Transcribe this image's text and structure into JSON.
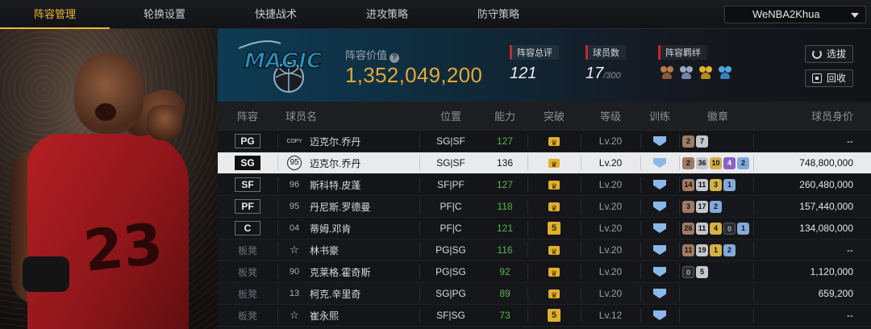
{
  "nav": {
    "tabs": [
      "阵容管理",
      "轮换设置",
      "快捷战术",
      "进攻策略",
      "防守策略"
    ],
    "active": 0,
    "account": "WeNBA2Khua"
  },
  "team": {
    "logo_text": "MAGIC",
    "value_label": "阵容价值",
    "value": "1,352,049,200",
    "overall_label": "阵容总评",
    "overall": "121",
    "players_label": "球员数",
    "players": "17",
    "players_max": "/300",
    "bond_label": "阵容羁绊",
    "bond_icons": [
      "bond-bronze-icon",
      "bond-silver-icon",
      "bond-gold-icon",
      "bond-blue-icon"
    ],
    "btn_select": "选拔",
    "btn_recycle": "回收"
  },
  "table": {
    "headers": [
      "阵容",
      "球员名",
      "位置",
      "能力",
      "突破",
      "等级",
      "训练",
      "徽章",
      "球员身价"
    ],
    "rows": [
      {
        "slot": "PG",
        "rank": "COPY",
        "name": "迈克尔.乔丹",
        "pos": "SG|SF",
        "ovr": "127",
        "brk": "",
        "lvl": "Lv.20",
        "badges": [
          {
            "t": "2",
            "c": "bronze"
          },
          {
            "t": "7",
            "c": "silver"
          }
        ],
        "price": "--"
      },
      {
        "slot": "SG",
        "rank": "95",
        "name": "迈克尔.乔丹",
        "pos": "SG|SF",
        "ovr": "136",
        "brk": "",
        "lvl": "Lv.20",
        "badges": [
          {
            "t": "2",
            "c": "bronze"
          },
          {
            "t": "36",
            "c": "silver"
          },
          {
            "t": "10",
            "c": "gold"
          },
          {
            "t": "4",
            "c": "purple"
          },
          {
            "t": "2",
            "c": "blue"
          }
        ],
        "price": "748,800,000"
      },
      {
        "slot": "SF",
        "rank": "96",
        "name": "斯科特.皮蓬",
        "pos": "SF|PF",
        "ovr": "127",
        "brk": "",
        "lvl": "Lv.20",
        "badges": [
          {
            "t": "14",
            "c": "bronze"
          },
          {
            "t": "11",
            "c": "silver"
          },
          {
            "t": "3",
            "c": "gold"
          },
          {
            "t": "1",
            "c": "blue"
          }
        ],
        "price": "260,480,000"
      },
      {
        "slot": "PF",
        "rank": "95",
        "name": "丹尼斯.罗德曼",
        "pos": "PF|C",
        "ovr": "118",
        "brk": "",
        "lvl": "Lv.20",
        "badges": [
          {
            "t": "3",
            "c": "bronze"
          },
          {
            "t": "17",
            "c": "silver"
          },
          {
            "t": "2",
            "c": "blue"
          }
        ],
        "price": "157,440,000"
      },
      {
        "slot": "C",
        "rank": "04",
        "name": "蒂姆.邓肯",
        "pos": "PF|C",
        "ovr": "121",
        "brk": "5",
        "lvl": "Lv.20",
        "badges": [
          {
            "t": "26",
            "c": "bronze"
          },
          {
            "t": "11",
            "c": "silver"
          },
          {
            "t": "4",
            "c": "gold"
          },
          {
            "t": "0",
            "c": "dark"
          },
          {
            "t": "1",
            "c": "blue"
          }
        ],
        "price": "134,080,000"
      },
      {
        "slot": "板凳",
        "rank": "☆",
        "name": "林书豪",
        "pos": "PG|SG",
        "ovr": "116",
        "brk": "",
        "lvl": "Lv.20",
        "badges": [
          {
            "t": "11",
            "c": "bronze"
          },
          {
            "t": "19",
            "c": "silver"
          },
          {
            "t": "1",
            "c": "gold"
          },
          {
            "t": "2",
            "c": "blue"
          }
        ],
        "price": "--"
      },
      {
        "slot": "板凳",
        "rank": "90",
        "name": "克莱格.霍奇斯",
        "pos": "PG|SG",
        "ovr": "92",
        "brk": "",
        "lvl": "Lv.20",
        "badges": [
          {
            "t": "0",
            "c": "dark"
          },
          {
            "t": "5",
            "c": "silver"
          }
        ],
        "price": "1,120,000"
      },
      {
        "slot": "板凳",
        "rank": "13",
        "name": "柯克.辛里奇",
        "pos": "SG|PG",
        "ovr": "89",
        "brk": "",
        "lvl": "Lv.20",
        "badges": [],
        "price": "659,200"
      },
      {
        "slot": "板凳",
        "rank": "☆",
        "name": "崔永熙",
        "pos": "SF|SG",
        "ovr": "73",
        "brk": "5",
        "lvl": "Lv.12",
        "badges": [],
        "price": "--"
      }
    ],
    "selected": 1
  },
  "colors": {
    "accent": "#f0b63a",
    "value_gold": "#e2a93a",
    "ovr_green": "#57b84a",
    "crown": "#e0b12d",
    "stat_marker": "#c9272b"
  }
}
